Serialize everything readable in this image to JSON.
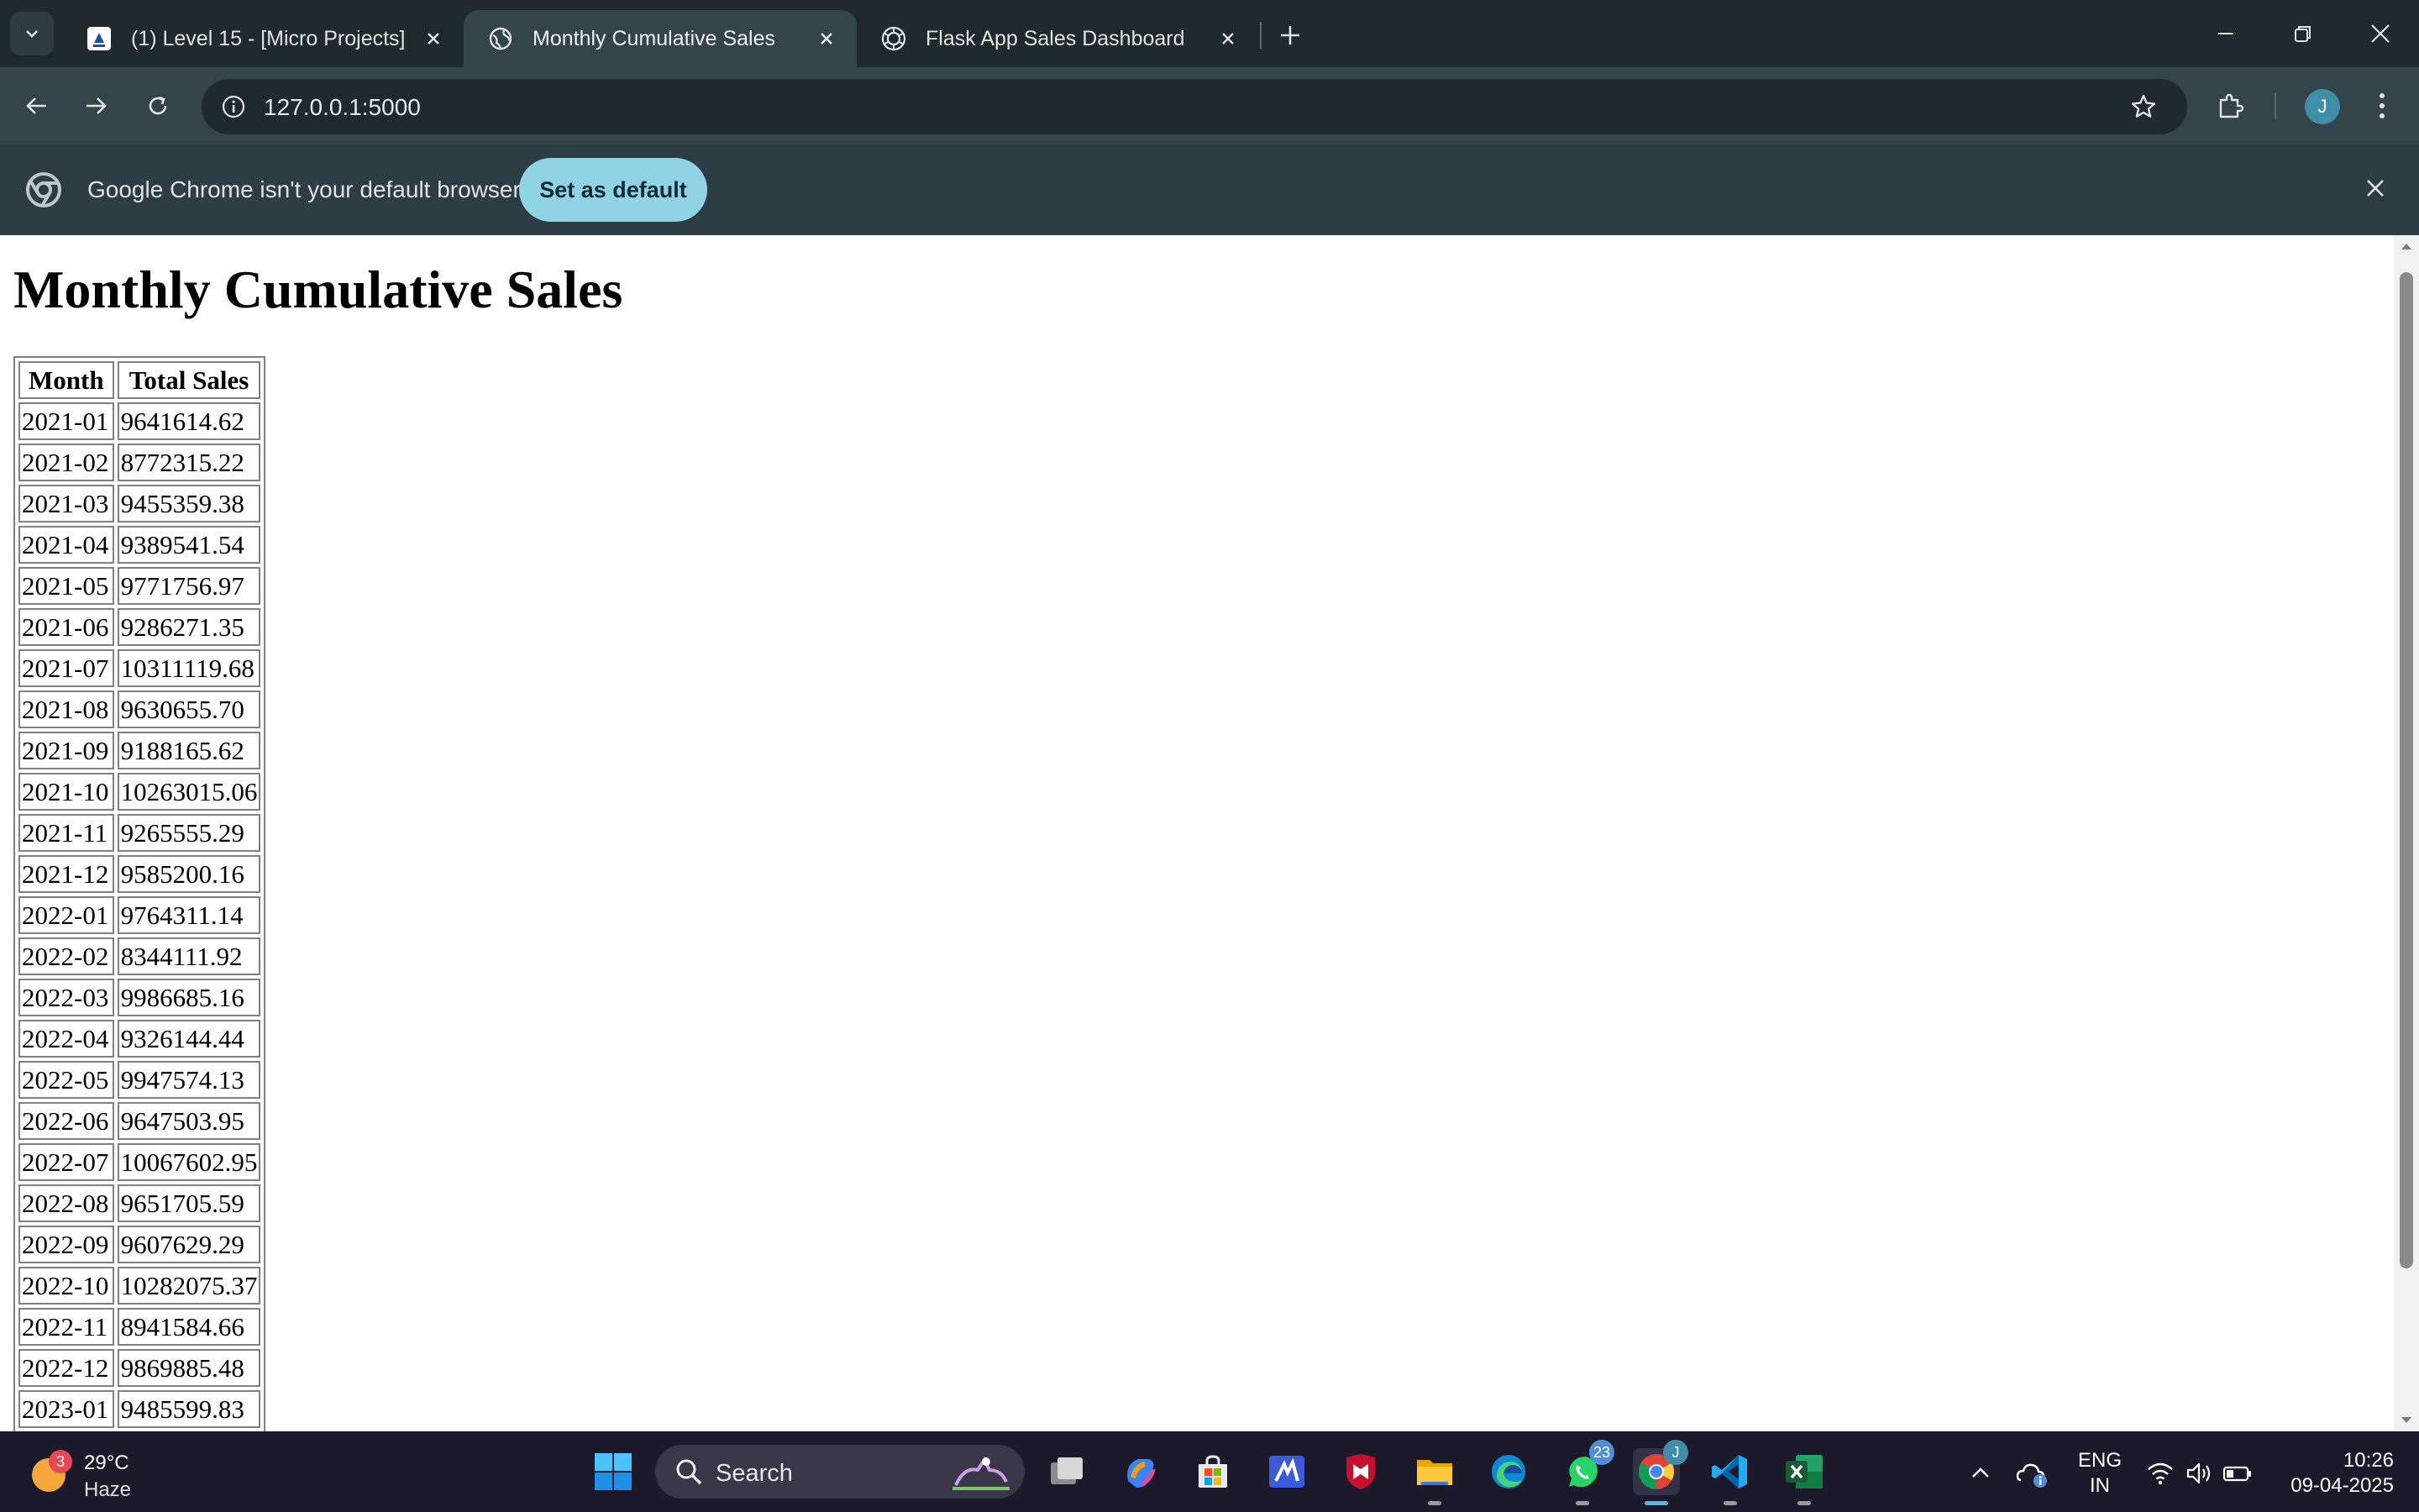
{
  "browser": {
    "tabs": [
      {
        "title": "(1) Level 15 - [Micro Projects]",
        "active": false
      },
      {
        "title": "Monthly Cumulative Sales",
        "active": true
      },
      {
        "title": "Flask App Sales Dashboard",
        "active": false
      }
    ],
    "url": "127.0.0.1:5000",
    "profile_initial": "J",
    "infobar": {
      "message": "Google Chrome isn't your default browser",
      "button": "Set as default"
    }
  },
  "page": {
    "heading": "Monthly Cumulative Sales",
    "table": {
      "headers": [
        "Month",
        "Total Sales"
      ],
      "rows": [
        [
          "2021-01",
          "9641614.62"
        ],
        [
          "2021-02",
          "8772315.22"
        ],
        [
          "2021-03",
          "9455359.38"
        ],
        [
          "2021-04",
          "9389541.54"
        ],
        [
          "2021-05",
          "9771756.97"
        ],
        [
          "2021-06",
          "9286271.35"
        ],
        [
          "2021-07",
          "10311119.68"
        ],
        [
          "2021-08",
          "9630655.70"
        ],
        [
          "2021-09",
          "9188165.62"
        ],
        [
          "2021-10",
          "10263015.06"
        ],
        [
          "2021-11",
          "9265555.29"
        ],
        [
          "2021-12",
          "9585200.16"
        ],
        [
          "2022-01",
          "9764311.14"
        ],
        [
          "2022-02",
          "8344111.92"
        ],
        [
          "2022-03",
          "9986685.16"
        ],
        [
          "2022-04",
          "9326144.44"
        ],
        [
          "2022-05",
          "9947574.13"
        ],
        [
          "2022-06",
          "9647503.95"
        ],
        [
          "2022-07",
          "10067602.95"
        ],
        [
          "2022-08",
          "9651705.59"
        ],
        [
          "2022-09",
          "9607629.29"
        ],
        [
          "2022-10",
          "10282075.37"
        ],
        [
          "2022-11",
          "8941584.66"
        ],
        [
          "2022-12",
          "9869885.48"
        ],
        [
          "2023-01",
          "9485599.83"
        ]
      ]
    }
  },
  "taskbar": {
    "weather": {
      "badge": "3",
      "temp": "29°C",
      "condition": "Haze"
    },
    "search_label": "Search",
    "whatsapp_badge": "23",
    "chrome_badge": "J",
    "lang_line1": "ENG",
    "lang_line2": "IN",
    "time": "10:26",
    "date": "09-04-2025"
  },
  "colors": {
    "tabstrip_bg": "#1e2a2e",
    "toolbar_bg": "#33454b",
    "infobar_bg": "#2c3d43",
    "set_default_btn": "#8fd3e4",
    "taskbar_bg": "#1c1a2a"
  }
}
